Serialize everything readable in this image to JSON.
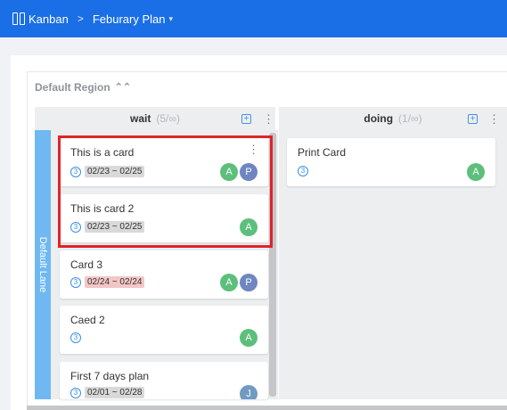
{
  "topbar": {
    "icon": "kanban-board-icon",
    "app_name": "Kanban",
    "separator": ">",
    "plan_name": "Feburary Plan",
    "caret": "▾"
  },
  "region": {
    "title": "Default Region",
    "collapse_icon": "double-chevron-up-icon",
    "collapse_glyph": "⌃⌃"
  },
  "lane": {
    "label": "Default Lane",
    "color": "#6fb8f2"
  },
  "columns": [
    {
      "name": "wait",
      "count": "(5/∞)",
      "add_glyph": "+",
      "more_glyph": "⋮"
    },
    {
      "name": "doing",
      "count": "(1/∞)",
      "add_glyph": "+",
      "more_glyph": "⋮"
    }
  ],
  "cards": [
    {
      "title": "This is a card",
      "priority": "3",
      "date": "02/23 ~ 02/25",
      "avatars": [
        "A",
        "P"
      ],
      "more_glyph": "⋮"
    },
    {
      "title": "This is card 2",
      "priority": "3",
      "date": "02/23 ~ 02/25",
      "avatars": [
        "A"
      ]
    },
    {
      "title": "Card 3",
      "priority": "3",
      "date": "02/24 ~ 02/24",
      "avatars": [
        "A",
        "P"
      ]
    },
    {
      "title": "Caed 2",
      "priority": "3",
      "avatars": [
        "A"
      ]
    },
    {
      "title": "First 7 days plan",
      "priority": "3",
      "date": "02/01 ~ 02/28",
      "avatars": [
        "J"
      ]
    },
    {
      "title": "Print Card",
      "priority": "3",
      "avatars": [
        "A"
      ]
    }
  ],
  "colors": {
    "header": "#1a6ee6",
    "avatar_a": "#5dbf7c",
    "avatar_p": "#6f86c1",
    "avatar_j": "#6f9bc1",
    "overdue_date": "#f3c6c6",
    "highlight": "#e0242b"
  }
}
